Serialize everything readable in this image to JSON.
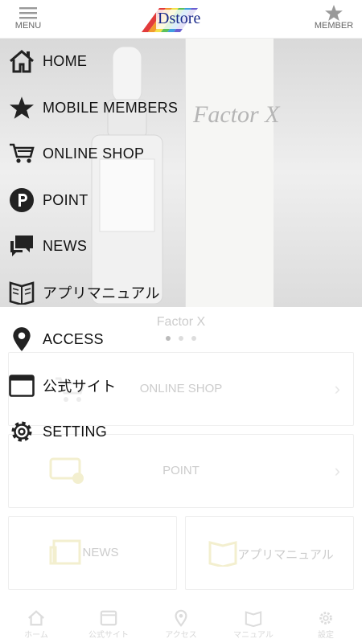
{
  "header": {
    "menu_label": "MENU",
    "member_label": "MEMBER",
    "logo_text": "Dstore"
  },
  "hero": {
    "caption": "Factor X",
    "box_text": "Factor X"
  },
  "cards": {
    "online_shop": "ONLINE SHOP",
    "point": "POINT",
    "news": "NEWS",
    "manual": "アプリマニュアル"
  },
  "tabbar": {
    "items": [
      {
        "label": "ホーム",
        "icon": "home-icon"
      },
      {
        "label": "公式サイト",
        "icon": "browser-icon"
      },
      {
        "label": "アクセス",
        "icon": "map-pin-icon"
      },
      {
        "label": "マニュアル",
        "icon": "book-icon"
      },
      {
        "label": "設定",
        "icon": "gear-icon"
      }
    ]
  },
  "menu": {
    "items": [
      {
        "label": "HOME",
        "icon": "home-icon"
      },
      {
        "label": "MOBILE MEMBERS",
        "icon": "star-icon"
      },
      {
        "label": "ONLINE SHOP",
        "icon": "cart-icon"
      },
      {
        "label": "POINT",
        "icon": "point-icon"
      },
      {
        "label": "NEWS",
        "icon": "chat-icon"
      },
      {
        "label": "アプリマニュアル",
        "icon": "book-icon"
      },
      {
        "label": "ACCESS",
        "icon": "map-pin-icon"
      },
      {
        "label": "公式サイト",
        "icon": "browser-icon"
      },
      {
        "label": "SETTING",
        "icon": "gear-icon"
      }
    ]
  },
  "colors": {
    "menu_text": "#111111",
    "faded_text": "#cccccc",
    "logo_blue": "#1a2a8a",
    "drawer_overlay": "rgba(255,255,255,0.78)"
  }
}
